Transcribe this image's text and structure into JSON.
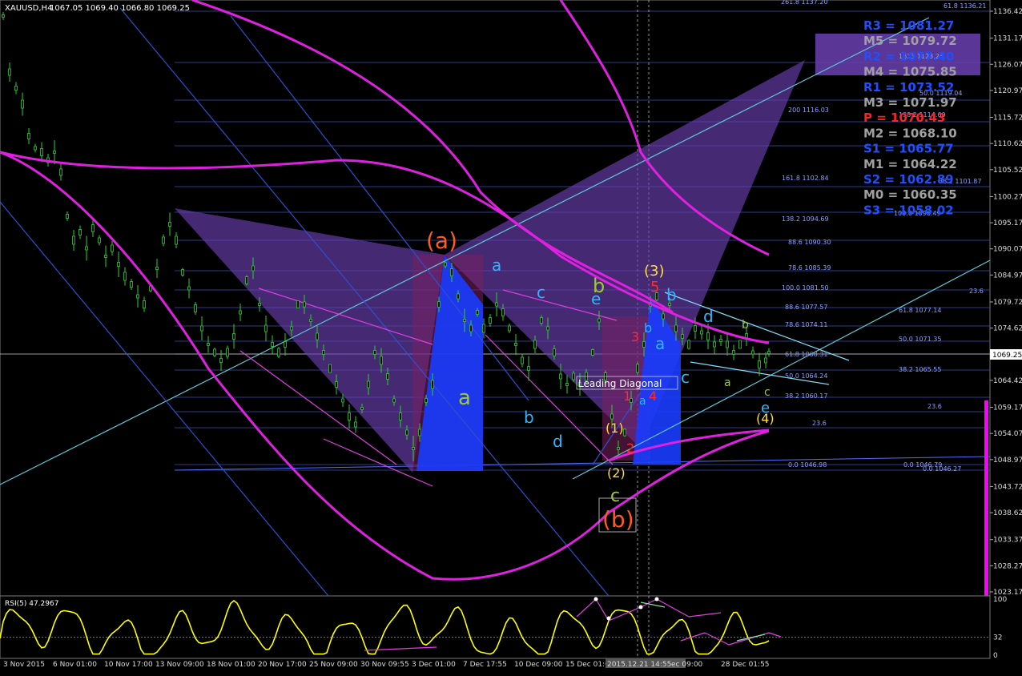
{
  "header": {
    "symbol": "XAUUSD,H4",
    "ohlc": "1067.05 1069.40 1066.80 1069.25"
  },
  "chart_data": {
    "type": "candlestick",
    "symbol": "XAUUSD",
    "timeframe": "H4",
    "ohlc_last": {
      "open": 1067.05,
      "high": 1069.4,
      "low": 1066.8,
      "close": 1069.25
    },
    "current_price_label": "1069.25",
    "ylim": [
      1021.5,
      1139.5
    ],
    "y_ticks": [
      "1136.42",
      "1131.17",
      "1126.07",
      "1120.97",
      "1115.72",
      "1110.62",
      "1105.52",
      "1100.27",
      "1095.17",
      "1090.07",
      "1084.97",
      "1079.72",
      "1074.62",
      "1069.52",
      "1064.42",
      "1059.17",
      "1054.07",
      "1048.97",
      "1043.72",
      "1038.62",
      "1033.37",
      "1028.27",
      "1023.17"
    ],
    "x_ticks": [
      "3 Nov 2015",
      "6 Nov 01:00",
      "10 Nov 17:00",
      "13 Nov 09:00",
      "18 Nov 01:00",
      "20 Nov 17:00",
      "25 Nov 09:00",
      "30 Nov 09:55",
      "3 Dec 01:00",
      "7 Dec 17:55",
      "10 Dec 09:00",
      "15 Dec 01:00",
      "2015.12.21 14:55",
      "ec 09:00",
      "28 Dec 01:55"
    ],
    "x_tick_highlight": "2015.12.21 14:55",
    "pivot_levels": [
      {
        "label": "R3 = 1081.27",
        "color": "#1f4fff"
      },
      {
        "label": "M5 = 1079.72",
        "color": "#a0a0a0"
      },
      {
        "label": "R2 = 1077.40",
        "color": "#1f4fff"
      },
      {
        "label": "M4 = 1075.85",
        "color": "#a0a0a0"
      },
      {
        "label": "R1 = 1073.52",
        "color": "#1f4fff"
      },
      {
        "label": "M3 = 1071.97",
        "color": "#a0a0a0"
      },
      {
        "label": "P = 1070.43",
        "color": "#ff2020"
      },
      {
        "label": "M2 = 1068.10",
        "color": "#a0a0a0"
      },
      {
        "label": "S1 = 1065.77",
        "color": "#1f4fff"
      },
      {
        "label": "M1 = 1064.22",
        "color": "#a0a0a0"
      },
      {
        "label": "S2 = 1062.89",
        "color": "#1f4fff"
      },
      {
        "label": "M0 = 1060.35",
        "color": "#a0a0a0"
      },
      {
        "label": "S3 = 1058.02",
        "color": "#1f4fff"
      }
    ],
    "fib_labels": [
      "61.8 1136.21",
      "261.8 1137.20",
      "1613 1123.25",
      "50.0 1119.04",
      "200 1116.03",
      "138.2 1114.69",
      "161.8 1102.84",
      "38.2 1101.87",
      "100.0 1096.49",
      "138.2 1094.69",
      "88.6 1090.30",
      "78.6 1085.39",
      "100.0 1081.50",
      "23.6",
      "88.6 1077.57",
      "61.8 1077.14",
      "78.6 1074.11",
      "50.0 1071.35",
      "61.8 1068.31",
      "38.2 1065.55",
      "50.0 1064.24",
      "38.2 1060.17",
      "23.6",
      "23.6",
      "0.0 1046.98",
      "0.0 1046.79",
      "0.0 1046.27"
    ],
    "wave_labels": [
      "(a)",
      "(b)",
      "a",
      "a",
      "b",
      "c",
      "d",
      "e",
      "b",
      "(3)",
      "5",
      "b",
      "3",
      "d",
      "b",
      "a",
      "c",
      "a",
      "1",
      "4",
      "a",
      "c",
      "e",
      "(4)",
      "(1)",
      "2",
      "(2)",
      "c",
      "a",
      "b",
      "c",
      "d",
      "e",
      "Leading Diagonal"
    ],
    "indicator": {
      "name": "RSI(5)",
      "value": "RSI(5) 47.2967",
      "ticks": [
        "100",
        "32",
        "0"
      ],
      "color": "#ffff00"
    }
  }
}
